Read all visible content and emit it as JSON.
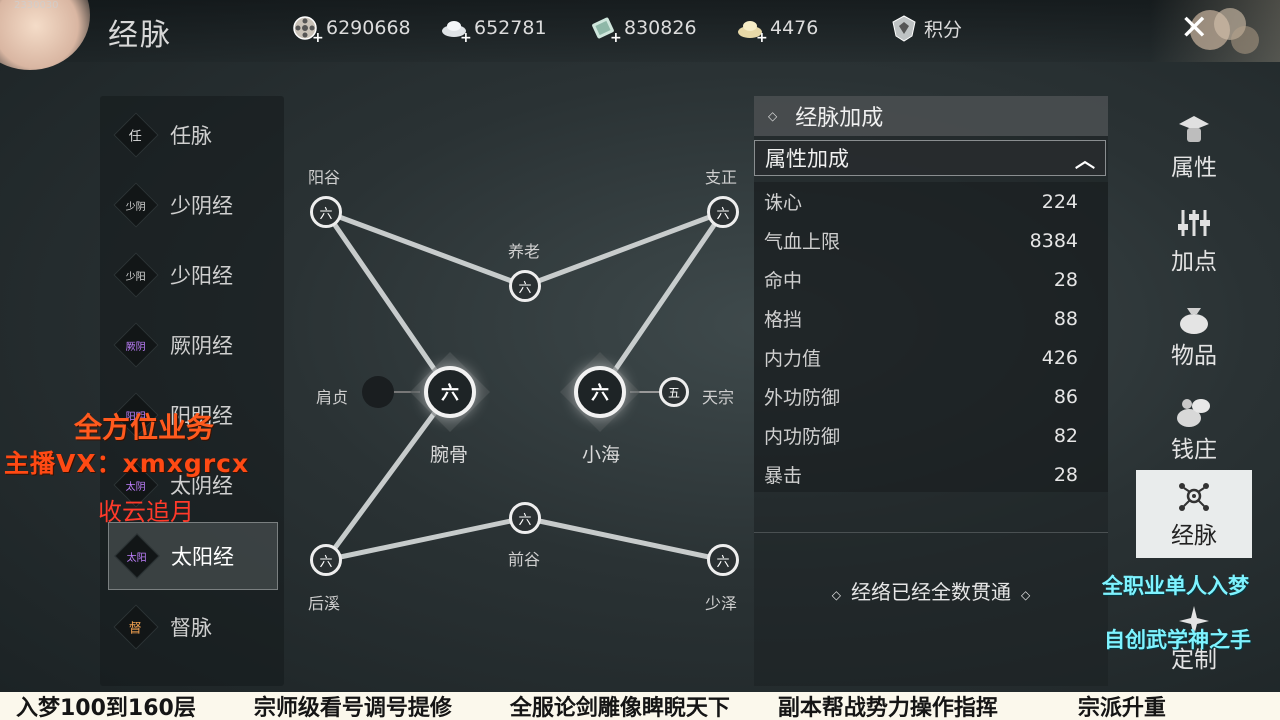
{
  "header": {
    "tiny_code": "2330030",
    "title": "经脉",
    "currencies": [
      {
        "icon": "film-reel-coin-icon",
        "value": "6290668",
        "has_plus": true
      },
      {
        "icon": "silver-ingot-icon",
        "value": "652781",
        "has_plus": true
      },
      {
        "icon": "jade-ticket-icon",
        "value": "830826",
        "has_plus": true
      },
      {
        "icon": "gold-ingot-icon",
        "value": "4476",
        "has_plus": true
      }
    ],
    "points_label": "积分"
  },
  "sidebar": {
    "items": [
      {
        "badge": "任",
        "label": "任脉"
      },
      {
        "badge": "少阴",
        "label": "少阴经"
      },
      {
        "badge": "少阳",
        "label": "少阳经"
      },
      {
        "badge": "厥阴",
        "label": "厥阴经"
      },
      {
        "badge": "阳明",
        "label": "阳明经"
      },
      {
        "badge": "太阴",
        "label": "太阴经"
      },
      {
        "badge": "太阳",
        "label": "太阳经"
      },
      {
        "badge": "督",
        "label": "督脉"
      }
    ],
    "active_index": 6
  },
  "graph": {
    "nodes": {
      "yanggu": {
        "label": "阳谷",
        "glyph": "六"
      },
      "zhizheng": {
        "label": "支正",
        "glyph": "六"
      },
      "yanglao": {
        "label": "养老",
        "glyph": "六"
      },
      "jianzhen": {
        "label": "肩贞",
        "glyph": ""
      },
      "wangu": {
        "label": "腕骨",
        "glyph": "六"
      },
      "xiaohai": {
        "label": "小海",
        "glyph": "六"
      },
      "tianzong": {
        "label": "天宗",
        "glyph": "五"
      },
      "qiangu": {
        "label": "前谷",
        "glyph": "六"
      },
      "houxi": {
        "label": "后溪",
        "glyph": "六"
      },
      "shaoze": {
        "label": "少泽",
        "glyph": "六"
      }
    }
  },
  "stats": {
    "header": "经脉加成",
    "section": "属性加成",
    "rows": [
      {
        "name": "诛心",
        "value": "224"
      },
      {
        "name": "气血上限",
        "value": "8384"
      },
      {
        "name": "命中",
        "value": "28"
      },
      {
        "name": "格挡",
        "value": "88"
      },
      {
        "name": "内力值",
        "value": "426"
      },
      {
        "name": "外功防御",
        "value": "86"
      },
      {
        "name": "内功防御",
        "value": "82"
      },
      {
        "name": "暴击",
        "value": "28"
      }
    ],
    "complete_text": "经络已经全数贯通"
  },
  "right_nav": {
    "items": [
      {
        "icon": "hat-icon",
        "label": "属性"
      },
      {
        "icon": "sliders-icon",
        "label": "加点"
      },
      {
        "icon": "bag-icon",
        "label": "物品"
      },
      {
        "icon": "money-bag-icon",
        "label": "钱庄"
      },
      {
        "icon": "meridian-icon",
        "label": "经脉"
      },
      {
        "icon": "sparkle-icon",
        "label": "定制"
      }
    ],
    "active_index": 4
  },
  "overlays": {
    "line1": "全方位业务",
    "line2": "主播VX：xmxgrcx",
    "line3": "收云追月",
    "right1": "全职业单人入梦",
    "right2": "自创武学神之手",
    "ticker": [
      "入梦100到160层",
      "宗师级看号调号提修",
      "全服论剑雕像睥睨天下",
      "副本帮战势力操作指挥",
      "宗派升重"
    ]
  },
  "colors": {
    "overlay_orange": "#ff5a1e",
    "overlay_cyan": "#7ff3ff",
    "active_nav_bg": "#e9ecec"
  }
}
